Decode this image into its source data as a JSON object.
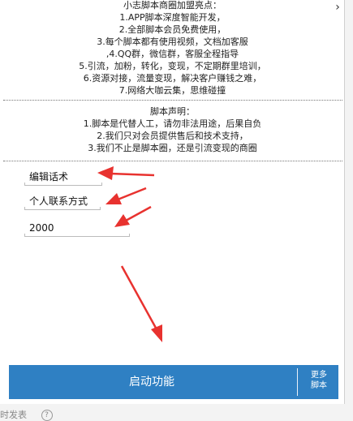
{
  "highlights": {
    "lines": [
      "小志脚本商圈加盟亮点：",
      "1.APP脚本深度智能开发，",
      "2.全部脚本会员免费使用，",
      "3.每个脚本都有使用视频，文档加客服",
      ",4.QQ群，微信群，客服全程指导",
      "5.引流，加粉，转化，变现，不定期群里培训，",
      "6.资源对接，流量变现，解决客户赚钱之难，",
      "7.网络大咖云集，思维碰撞"
    ]
  },
  "statement": {
    "lines": [
      "脚本声明：",
      "1.脚本是代替人工，请勿非法用途，后果自负",
      "2.我们只对会员提供售后和技术支持，",
      "3.我们不止是脚本圈，还是引流变现的商圈"
    ]
  },
  "fields": {
    "script_text": "编辑话术",
    "contact": "个人联系方式",
    "number": "2000"
  },
  "buttons": {
    "start": "启动功能",
    "more_line1": "更多",
    "more_line2": "脚本"
  },
  "footer": {
    "text": "时发表",
    "help_glyph": "?"
  },
  "colors": {
    "bar": "#2f80c3",
    "arrow": "#e8322f"
  }
}
